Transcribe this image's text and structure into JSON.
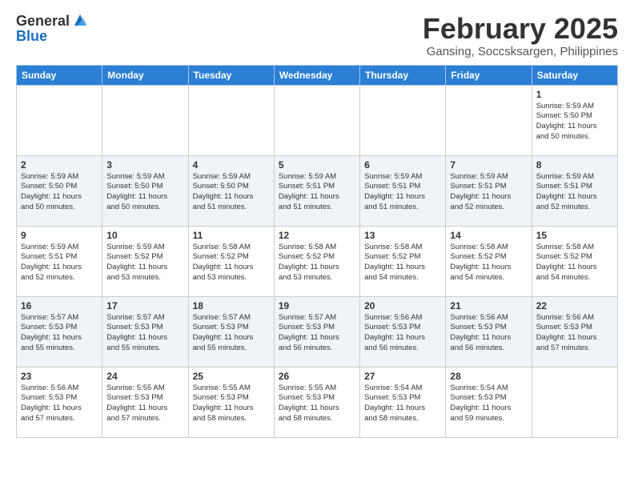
{
  "header": {
    "logo_general": "General",
    "logo_blue": "Blue",
    "month_title": "February 2025",
    "location": "Gansing, Soccsksargen, Philippines"
  },
  "weekdays": [
    "Sunday",
    "Monday",
    "Tuesday",
    "Wednesday",
    "Thursday",
    "Friday",
    "Saturday"
  ],
  "weeks": [
    [
      {
        "day": "",
        "info": ""
      },
      {
        "day": "",
        "info": ""
      },
      {
        "day": "",
        "info": ""
      },
      {
        "day": "",
        "info": ""
      },
      {
        "day": "",
        "info": ""
      },
      {
        "day": "",
        "info": ""
      },
      {
        "day": "1",
        "info": "Sunrise: 5:59 AM\nSunset: 5:50 PM\nDaylight: 11 hours\nand 50 minutes."
      }
    ],
    [
      {
        "day": "2",
        "info": "Sunrise: 5:59 AM\nSunset: 5:50 PM\nDaylight: 11 hours\nand 50 minutes."
      },
      {
        "day": "3",
        "info": "Sunrise: 5:59 AM\nSunset: 5:50 PM\nDaylight: 11 hours\nand 50 minutes."
      },
      {
        "day": "4",
        "info": "Sunrise: 5:59 AM\nSunset: 5:50 PM\nDaylight: 11 hours\nand 51 minutes."
      },
      {
        "day": "5",
        "info": "Sunrise: 5:59 AM\nSunset: 5:51 PM\nDaylight: 11 hours\nand 51 minutes."
      },
      {
        "day": "6",
        "info": "Sunrise: 5:59 AM\nSunset: 5:51 PM\nDaylight: 11 hours\nand 51 minutes."
      },
      {
        "day": "7",
        "info": "Sunrise: 5:59 AM\nSunset: 5:51 PM\nDaylight: 11 hours\nand 52 minutes."
      },
      {
        "day": "8",
        "info": "Sunrise: 5:59 AM\nSunset: 5:51 PM\nDaylight: 11 hours\nand 52 minutes."
      }
    ],
    [
      {
        "day": "9",
        "info": "Sunrise: 5:59 AM\nSunset: 5:51 PM\nDaylight: 11 hours\nand 52 minutes."
      },
      {
        "day": "10",
        "info": "Sunrise: 5:59 AM\nSunset: 5:52 PM\nDaylight: 11 hours\nand 53 minutes."
      },
      {
        "day": "11",
        "info": "Sunrise: 5:58 AM\nSunset: 5:52 PM\nDaylight: 11 hours\nand 53 minutes."
      },
      {
        "day": "12",
        "info": "Sunrise: 5:58 AM\nSunset: 5:52 PM\nDaylight: 11 hours\nand 53 minutes."
      },
      {
        "day": "13",
        "info": "Sunrise: 5:58 AM\nSunset: 5:52 PM\nDaylight: 11 hours\nand 54 minutes."
      },
      {
        "day": "14",
        "info": "Sunrise: 5:58 AM\nSunset: 5:52 PM\nDaylight: 11 hours\nand 54 minutes."
      },
      {
        "day": "15",
        "info": "Sunrise: 5:58 AM\nSunset: 5:52 PM\nDaylight: 11 hours\nand 54 minutes."
      }
    ],
    [
      {
        "day": "16",
        "info": "Sunrise: 5:57 AM\nSunset: 5:53 PM\nDaylight: 11 hours\nand 55 minutes."
      },
      {
        "day": "17",
        "info": "Sunrise: 5:57 AM\nSunset: 5:53 PM\nDaylight: 11 hours\nand 55 minutes."
      },
      {
        "day": "18",
        "info": "Sunrise: 5:57 AM\nSunset: 5:53 PM\nDaylight: 11 hours\nand 55 minutes."
      },
      {
        "day": "19",
        "info": "Sunrise: 5:57 AM\nSunset: 5:53 PM\nDaylight: 11 hours\nand 56 minutes."
      },
      {
        "day": "20",
        "info": "Sunrise: 5:56 AM\nSunset: 5:53 PM\nDaylight: 11 hours\nand 56 minutes."
      },
      {
        "day": "21",
        "info": "Sunrise: 5:56 AM\nSunset: 5:53 PM\nDaylight: 11 hours\nand 56 minutes."
      },
      {
        "day": "22",
        "info": "Sunrise: 5:56 AM\nSunset: 5:53 PM\nDaylight: 11 hours\nand 57 minutes."
      }
    ],
    [
      {
        "day": "23",
        "info": "Sunrise: 5:56 AM\nSunset: 5:53 PM\nDaylight: 11 hours\nand 57 minutes."
      },
      {
        "day": "24",
        "info": "Sunrise: 5:55 AM\nSunset: 5:53 PM\nDaylight: 11 hours\nand 57 minutes."
      },
      {
        "day": "25",
        "info": "Sunrise: 5:55 AM\nSunset: 5:53 PM\nDaylight: 11 hours\nand 58 minutes."
      },
      {
        "day": "26",
        "info": "Sunrise: 5:55 AM\nSunset: 5:53 PM\nDaylight: 11 hours\nand 58 minutes."
      },
      {
        "day": "27",
        "info": "Sunrise: 5:54 AM\nSunset: 5:53 PM\nDaylight: 11 hours\nand 58 minutes."
      },
      {
        "day": "28",
        "info": "Sunrise: 5:54 AM\nSunset: 5:53 PM\nDaylight: 11 hours\nand 59 minutes."
      },
      {
        "day": "",
        "info": ""
      }
    ]
  ]
}
